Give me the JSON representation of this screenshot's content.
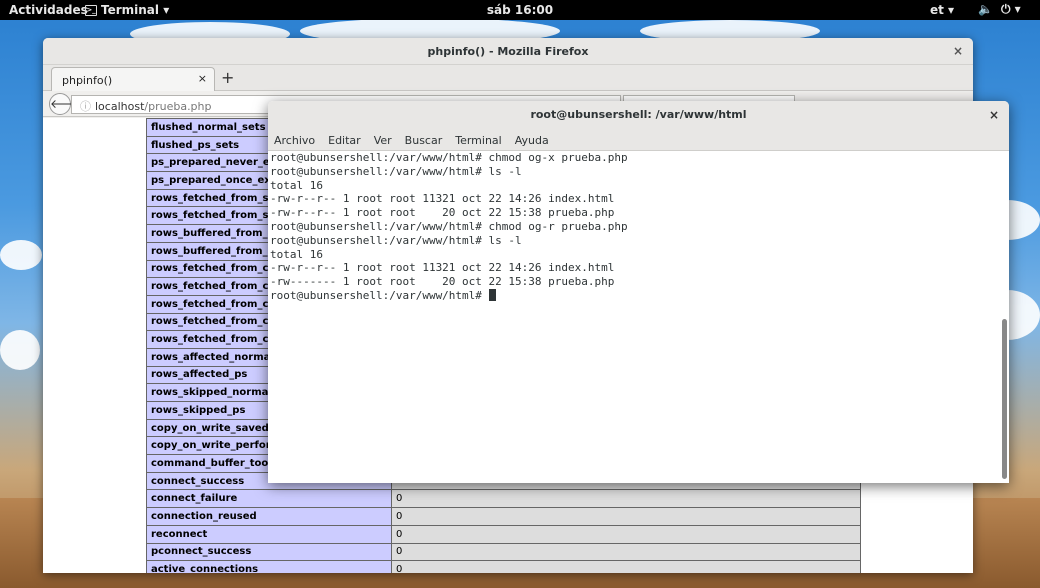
{
  "topbar": {
    "activities": "Actividades",
    "app_name": "Terminal ▾",
    "clock": "sáb 16:00",
    "keyboard": "et ▾",
    "system": [
      "🔈",
      "⏻ ▾"
    ]
  },
  "firefox": {
    "title": "phpinfo() - Mozilla Firefox",
    "close": "×",
    "tab_label": "phpinfo()",
    "tab_close": "×",
    "new_tab": "+",
    "back": "🡐",
    "url_host": "localhost",
    "url_path": "/prueba.php",
    "url_info": "ⓘ"
  },
  "php_rows": [
    [
      "flushed_normal_sets",
      ""
    ],
    [
      "flushed_ps_sets",
      ""
    ],
    [
      "ps_prepared_never_executed",
      ""
    ],
    [
      "ps_prepared_once_executed",
      ""
    ],
    [
      "rows_fetched_from_server_normal",
      ""
    ],
    [
      "rows_fetched_from_server_ps",
      ""
    ],
    [
      "rows_buffered_from_client_normal",
      ""
    ],
    [
      "rows_buffered_from_client_ps",
      ""
    ],
    [
      "rows_fetched_from_client_normal_buffered",
      ""
    ],
    [
      "rows_fetched_from_client_normal_unbuffered",
      ""
    ],
    [
      "rows_fetched_from_client_ps_buffered",
      ""
    ],
    [
      "rows_fetched_from_client_ps_unbuffered",
      ""
    ],
    [
      "rows_fetched_from_client_ps_cursor",
      ""
    ],
    [
      "rows_affected_normal",
      ""
    ],
    [
      "rows_affected_ps",
      ""
    ],
    [
      "rows_skipped_normal",
      ""
    ],
    [
      "rows_skipped_ps",
      ""
    ],
    [
      "copy_on_write_saved",
      ""
    ],
    [
      "copy_on_write_performed",
      ""
    ],
    [
      "command_buffer_too_small",
      ""
    ],
    [
      "connect_success",
      ""
    ],
    [
      "connect_failure",
      "0"
    ],
    [
      "connection_reused",
      "0"
    ],
    [
      "reconnect",
      "0"
    ],
    [
      "pconnect_success",
      "0"
    ],
    [
      "active_connections",
      "0"
    ]
  ],
  "terminal": {
    "title": "root@ubunsershell: /var/www/html",
    "close": "×",
    "menu": [
      "Archivo",
      "Editar",
      "Ver",
      "Buscar",
      "Terminal",
      "Ayuda"
    ],
    "lines": [
      "root@ubunsershell:/var/www/html# chmod og-x prueba.php",
      "root@ubunsershell:/var/www/html# ls -l",
      "total 16",
      "-rw-r--r-- 1 root root 11321 oct 22 14:26 index.html",
      "-rw-r--r-- 1 root root    20 oct 22 15:38 prueba.php",
      "root@ubunsershell:/var/www/html# chmod og-r prueba.php",
      "root@ubunsershell:/var/www/html# ls -l",
      "total 16",
      "-rw-r--r-- 1 root root 11321 oct 22 14:26 index.html",
      "-rw------- 1 root root    20 oct 22 15:38 prueba.php"
    ],
    "prompt": "root@ubunsershell:/var/www/html# "
  }
}
